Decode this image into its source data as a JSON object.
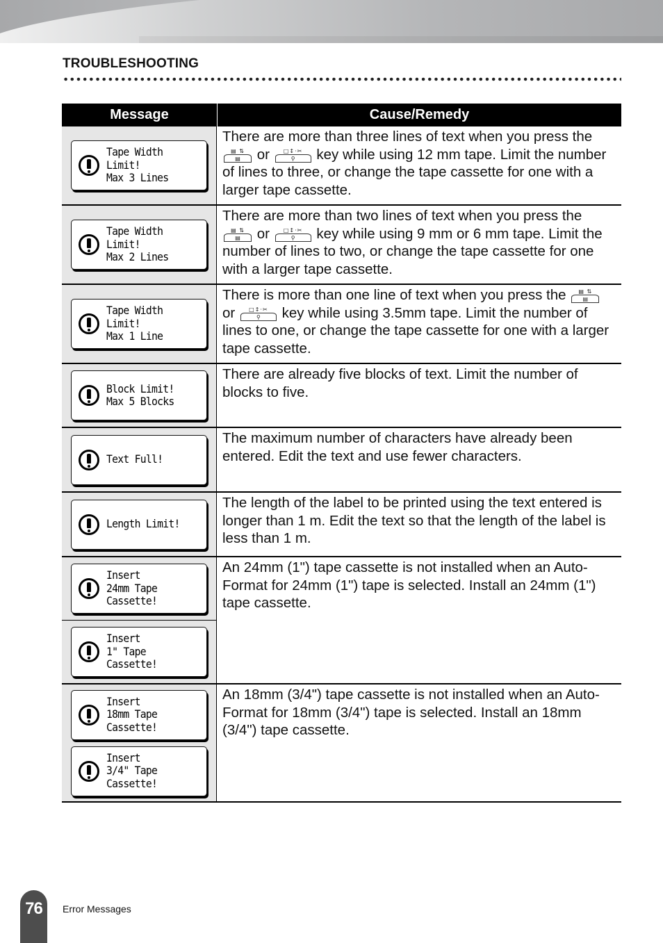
{
  "header": {
    "section_title": "TROUBLESHOOTING"
  },
  "table": {
    "columns": [
      "Message",
      "Cause/Remedy"
    ],
    "rows": [
      {
        "messages": [
          [
            "Tape Width",
            "Limit!",
            "Max 3 Lines"
          ]
        ],
        "remedy_parts": [
          "There are more than three lines of text when you press the",
          "or",
          "key while using 12 mm tape. Limit the number of lines to three, or change the tape cassette for one with a larger tape cassette."
        ]
      },
      {
        "messages": [
          [
            "Tape Width",
            "Limit!",
            "Max 2 Lines"
          ]
        ],
        "remedy_parts": [
          "There are more than two lines of text when you press the",
          "or",
          "key while using 9 mm or 6 mm tape. Limit the number of lines to two, or change the tape cassette for one with a larger tape cassette."
        ]
      },
      {
        "messages": [
          [
            "Tape Width",
            "Limit!",
            "Max 1 Line"
          ]
        ],
        "remedy_parts": [
          "There is more than one line of text when you press the",
          "or",
          "key while using 3.5mm tape. Limit the number of lines to one, or change the tape cassette for one with a larger tape cassette."
        ]
      },
      {
        "messages": [
          [
            "Block Limit!",
            "Max 5 Blocks"
          ]
        ],
        "remedy": "There are already five blocks of text. Limit the number of blocks to five."
      },
      {
        "messages": [
          [
            "Text Full!"
          ]
        ],
        "remedy": "The maximum number of characters have already been entered. Edit the text and use fewer characters."
      },
      {
        "messages": [
          [
            "Length Limit!"
          ]
        ],
        "remedy": "The length of the label to be printed using the text entered is longer than 1 m. Edit the text so that the length of the label is less than 1 m."
      },
      {
        "messages": [
          [
            "Insert",
            "24mm Tape",
            "Cassette!"
          ],
          [
            "Insert",
            "1\" Tape",
            "Cassette!"
          ]
        ],
        "remedy": "An 24mm (1\") tape cassette is not installed when an Auto-Format for 24mm (1\") tape is selected. Install an 24mm (1\") tape cassette."
      },
      {
        "messages": [
          [
            "Insert",
            "18mm Tape",
            "Cassette!"
          ],
          [
            "Insert",
            "3/4\" Tape",
            "Cassette!"
          ]
        ],
        "remedy": "An 18mm (3/4\") tape cassette is not installed when an Auto-Format for 18mm (3/4\") tape is selected. Install an 18mm (3/4\") tape cassette."
      }
    ]
  },
  "keys": {
    "align_key": {
      "top": "▤ ⇅",
      "cap": "▤",
      "icon": "text-align-key-icon"
    },
    "preview_key": {
      "top": "□↕·✂",
      "cap": "⚲",
      "icon": "preview-key-icon"
    }
  },
  "footer": {
    "page_number": "76",
    "section_label": "Error Messages"
  }
}
